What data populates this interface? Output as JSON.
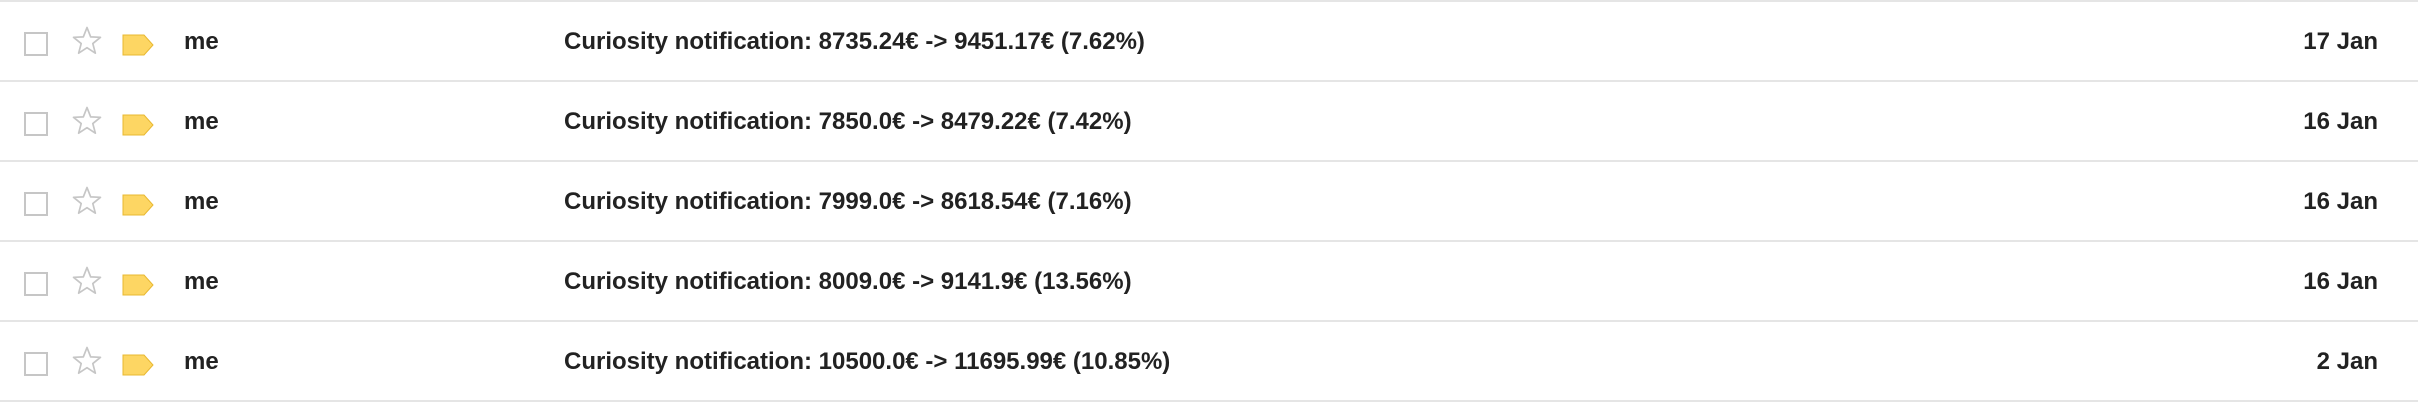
{
  "colors": {
    "row_border": "#e5e5e5",
    "checkbox_border": "#c6c6c6",
    "star_outline": "#c6c6c6",
    "label_tag": "#fdd663",
    "text": "#222222"
  },
  "icons": {
    "checkbox": "checkbox-icon",
    "star": "star-outline-icon",
    "label": "label-tag-icon"
  },
  "messages": [
    {
      "sender": "me",
      "subject": "Curiosity notification: 8735.24€ -> 9451.17€ (7.62%)",
      "date": "17 Jan"
    },
    {
      "sender": "me",
      "subject": "Curiosity notification: 7850.0€ -> 8479.22€ (7.42%)",
      "date": "16 Jan"
    },
    {
      "sender": "me",
      "subject": "Curiosity notification: 7999.0€ -> 8618.54€ (7.16%)",
      "date": "16 Jan"
    },
    {
      "sender": "me",
      "subject": "Curiosity notification: 8009.0€ -> 9141.9€ (13.56%)",
      "date": "16 Jan"
    },
    {
      "sender": "me",
      "subject": "Curiosity notification: 10500.0€ -> 11695.99€ (10.85%)",
      "date": "2 Jan"
    }
  ]
}
